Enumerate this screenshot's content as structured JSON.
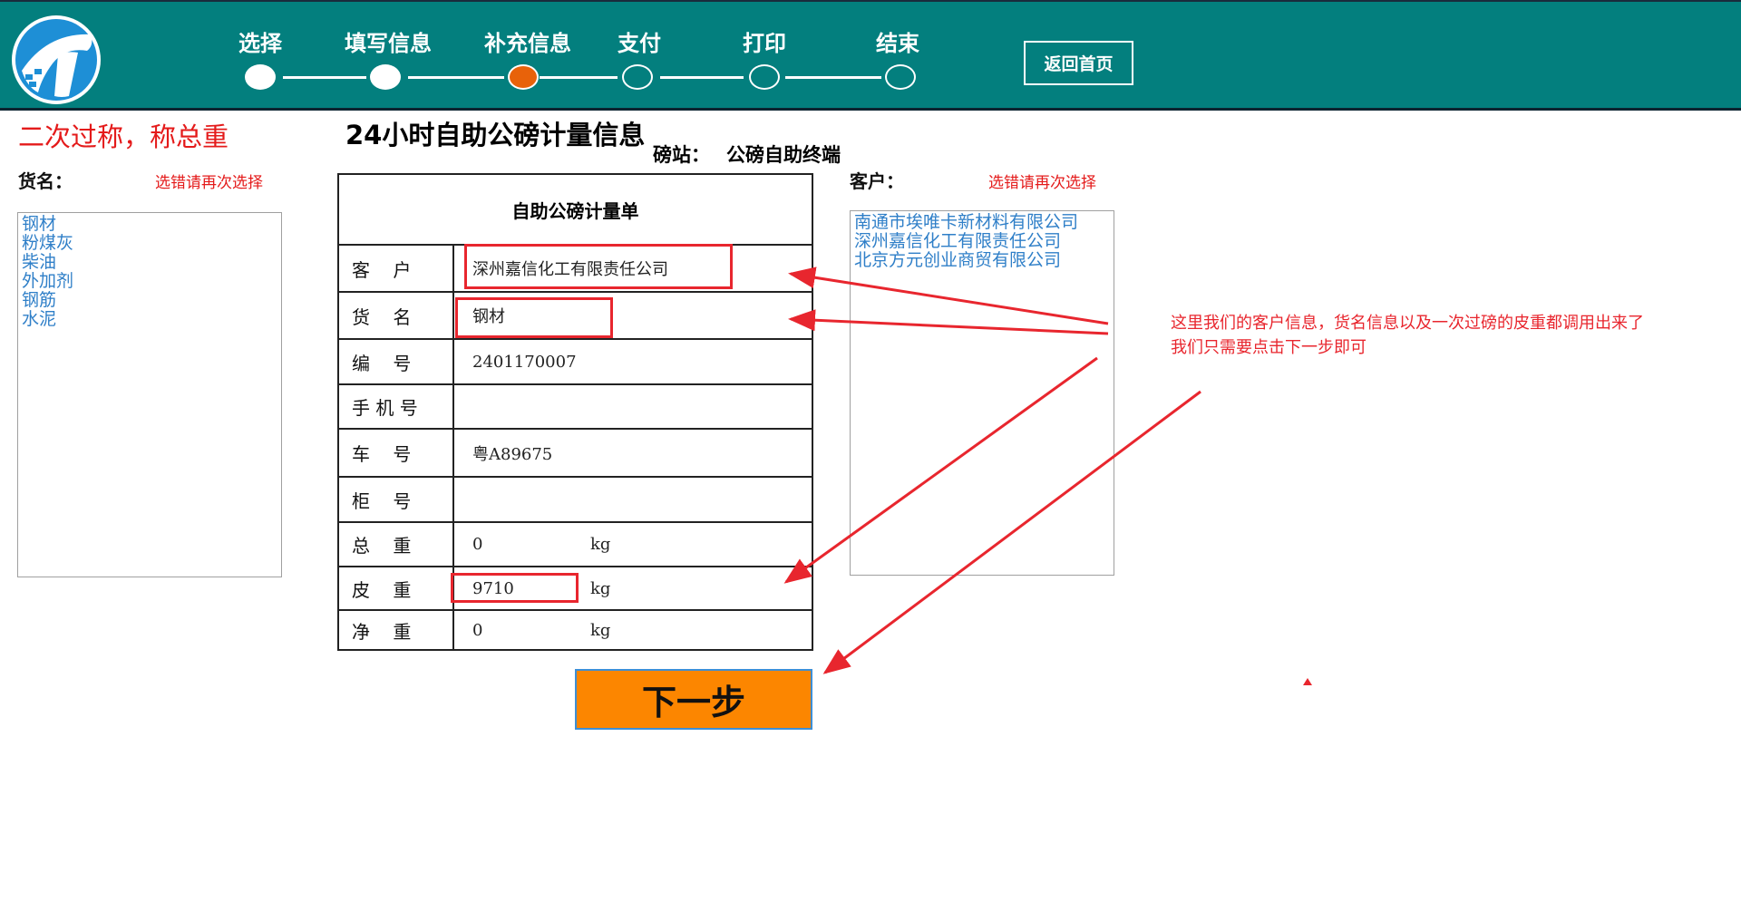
{
  "header": {
    "logo_icon": "road-logo-icon",
    "steps": [
      {
        "label": "选择",
        "state": "done"
      },
      {
        "label": "填写信息",
        "state": "done"
      },
      {
        "label": "补充信息",
        "state": "active"
      },
      {
        "label": "支付",
        "state": "pending"
      },
      {
        "label": "打印",
        "state": "pending"
      },
      {
        "label": "结束",
        "state": "pending"
      }
    ],
    "home_button": "返回首页",
    "colors": {
      "bar": "#037f7e",
      "active_step": "#e8620a"
    }
  },
  "left": {
    "instruction": "二次过称，称总重",
    "goods_label": "货名：",
    "goods_hint": "选错请再次选择",
    "goods_options": [
      "钢材",
      "粉煤灰",
      "柴油",
      "外加剂",
      "钢筋",
      "水泥"
    ]
  },
  "center": {
    "title": "24小时自助公磅计量信息",
    "station_label": "磅站：",
    "station_value": "公磅自助终端",
    "form_title": "自助公磅计量单",
    "rows": {
      "customer": {
        "label": "客    户",
        "value": "深州嘉信化工有限责任公司"
      },
      "goods": {
        "label": "货    名",
        "value": "钢材"
      },
      "serial": {
        "label": "编    号",
        "value": "2401170007"
      },
      "phone": {
        "label": "手 机 号",
        "value": ""
      },
      "plate": {
        "label": "车    号",
        "value": "粤A89675"
      },
      "cabinet": {
        "label": "柜    号",
        "value": ""
      },
      "gross": {
        "label": "总    重",
        "value": "0",
        "unit": "kg"
      },
      "tare": {
        "label": "皮    重",
        "value": "9710",
        "unit": "kg"
      },
      "net": {
        "label": "净    重",
        "value": "0",
        "unit": "kg"
      }
    },
    "next_button": "下一步"
  },
  "right": {
    "customer_label": "客户：",
    "customer_hint": "选错请再次选择",
    "customer_options": [
      "南通市埃唯卡新材料有限公司",
      "深州嘉信化工有限责任公司",
      "北京方元创业商贸有限公司"
    ]
  },
  "annotation": {
    "lines": [
      "这里我们的客户信息，货名信息以及一次过磅的皮重都调用出来了",
      "我们只需要点击下一步即可"
    ],
    "color": "#e8262e"
  }
}
